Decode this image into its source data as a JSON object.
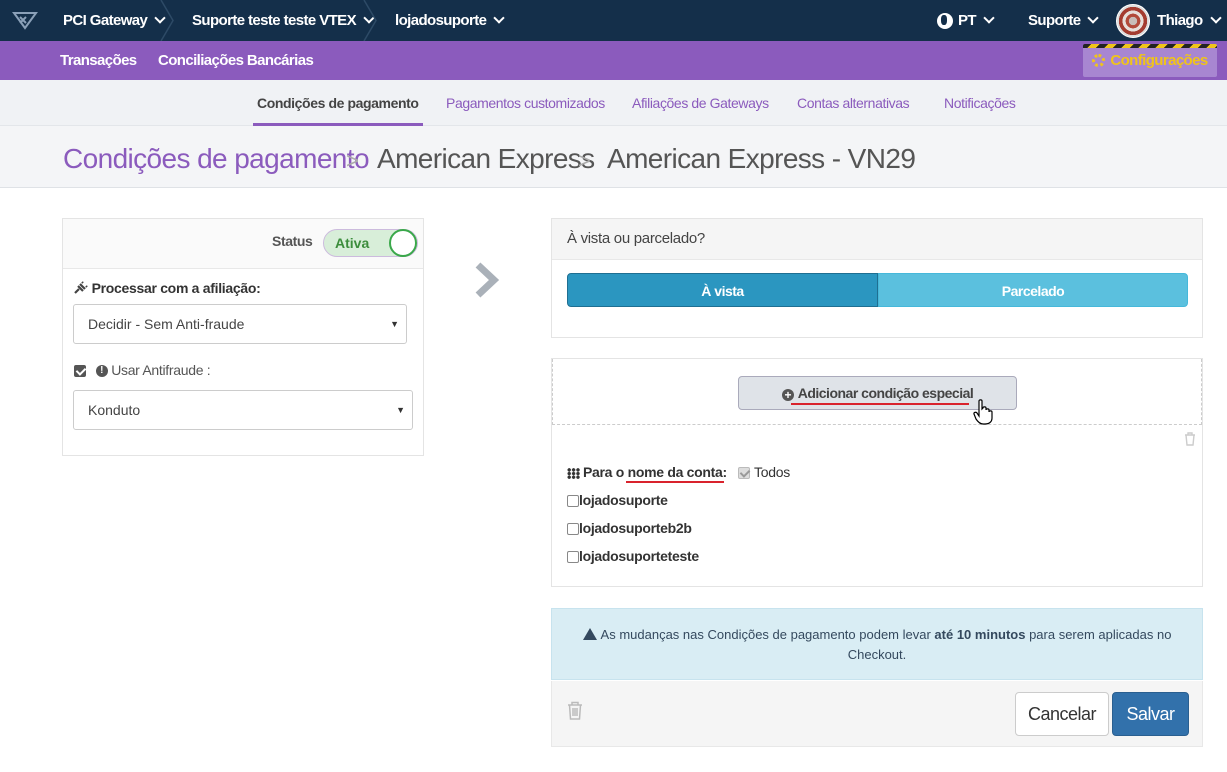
{
  "topbar": {
    "brand": "PCI Gateway",
    "account": "Suporte teste teste VTEX",
    "store": "lojadosuporte",
    "language": "PT",
    "support": "Suporte",
    "user": "Thiago"
  },
  "mainnav": {
    "transactions": "Transações",
    "reconciliations": "Conciliações Bancárias",
    "settings": "Configurações"
  },
  "subnav": {
    "tabs": [
      {
        "label": "Condições de pagamento"
      },
      {
        "label": "Pagamentos customizados"
      },
      {
        "label": "Afiliações de Gateways"
      },
      {
        "label": "Contas alternativas"
      },
      {
        "label": "Notificações"
      }
    ]
  },
  "breadcrumb": {
    "level1": "Condições de pagamento",
    "level2": "American Express",
    "level3": "American Express - VN29"
  },
  "left_panel": {
    "status_label": "Status",
    "status_value": "Ativa",
    "affiliation_label": "Processar com a afiliação:",
    "affiliation_value": "Decidir - Sem Anti-fraude",
    "antifraud_label": "Usar Antifraude :",
    "antifraud_checked": true,
    "antifraud_value": "Konduto"
  },
  "installments": {
    "heading": "À vista ou parcelado?",
    "option_cash": "À vista",
    "option_installments": "Parcelado"
  },
  "special_conditions": {
    "add_button": "Adicionar condição especial",
    "account_label_prefix": "Para o ",
    "account_label_main": "nome da conta:",
    "all_label": "Todos",
    "accounts": [
      {
        "name": "lojadosuporte"
      },
      {
        "name": "lojadosuporteb2b"
      },
      {
        "name": "lojadosuporteteste"
      }
    ]
  },
  "alert": {
    "text_before": "As mudanças nas Condições de pagamento podem levar ",
    "text_bold": "até 10 minutos",
    "text_after": " para serem aplicadas no Checkout."
  },
  "footer": {
    "cancel": "Cancelar",
    "save": "Salvar"
  },
  "colors": {
    "topbar": "#142f4a",
    "purple": "#8b5bbd",
    "primary": "#3271ab",
    "info": "#5bc0de"
  }
}
